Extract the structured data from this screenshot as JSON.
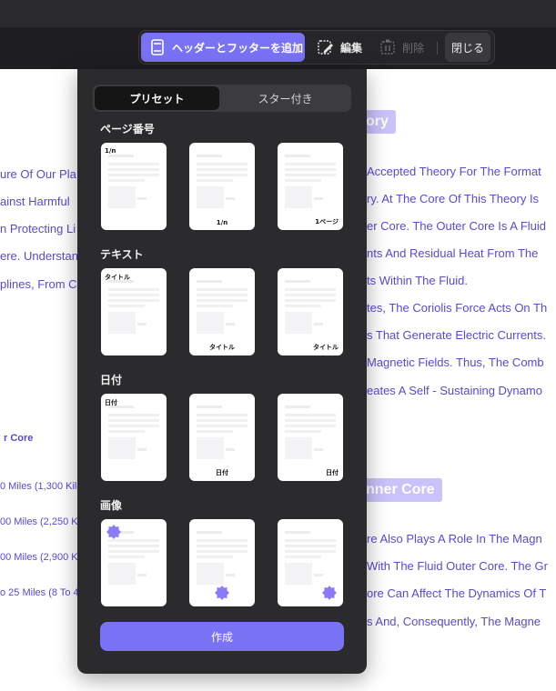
{
  "toolbar": {
    "header_footer_label": "ヘッダーとフッターを追加",
    "edit_label": "編集",
    "delete_label": "削除",
    "close_label": "閉じる"
  },
  "document": {
    "right_heading_1": "ory",
    "right_heading_2": "nner Core",
    "left_lines": [
      "ure Of Our Pla",
      "ainst Harmful",
      "n Protecting Li",
      "ere. Understan",
      "plines, From C"
    ],
    "right_lines_1": [
      "Accepted Theory For The Format",
      "ry. At The Core Of This Theory Is",
      "er Core. The Outer Core Is A Fluid",
      "nts And Residual Heat From The",
      "ts Within The Fluid.",
      "tes, The Coriolis Force Acts On Th",
      "s That Generate Electric Currents.",
      "Magnetic Fields. Thus, The Comb",
      "eates A Self - Sustaining Dynamo"
    ],
    "right_lines_2": [
      "re Also Plays A Role In The Magn",
      "With The Fluid Outer Core. The Gr",
      "ore Can Affect The Dynamics Of T",
      "s And, Consequently, The Magne"
    ],
    "left_small_heading": "r Core",
    "left_small_lines": [
      "0 Miles (1,300 Kilo",
      "00 Miles (2,250 K",
      "00 Miles (2,900 K",
      "o 25 Miles (8 To 4"
    ]
  },
  "panel": {
    "tabs": [
      "プリセット",
      "スター付き"
    ],
    "active_tab": "プリセット",
    "sections": [
      {
        "title": "ページ番号",
        "cards": [
          {
            "label": "1/n",
            "pos": "top-left"
          },
          {
            "label": "1/n",
            "pos": "bottom-center"
          },
          {
            "label": "1ページ",
            "pos": "bottom-right"
          }
        ]
      },
      {
        "title": "テキスト",
        "cards": [
          {
            "label": "タイトル",
            "pos": "top-left"
          },
          {
            "label": "タイトル",
            "pos": "bottom-center"
          },
          {
            "label": "タイトル",
            "pos": "bottom-right"
          }
        ]
      },
      {
        "title": "日付",
        "cards": [
          {
            "label": "日付",
            "pos": "top-left"
          },
          {
            "label": "日付",
            "pos": "bottom-center"
          },
          {
            "label": "日付",
            "pos": "bottom-right"
          }
        ]
      },
      {
        "title": "画像",
        "cards": [
          {
            "label": "",
            "pos": "top-left"
          },
          {
            "label": "",
            "pos": "bottom-center"
          },
          {
            "label": "",
            "pos": "bottom-right"
          }
        ]
      }
    ],
    "create_label": "作成"
  },
  "colors": {
    "accent": "#7a72f5",
    "panel_bg": "#2b2b2d",
    "doc_text": "#5b48d6"
  }
}
